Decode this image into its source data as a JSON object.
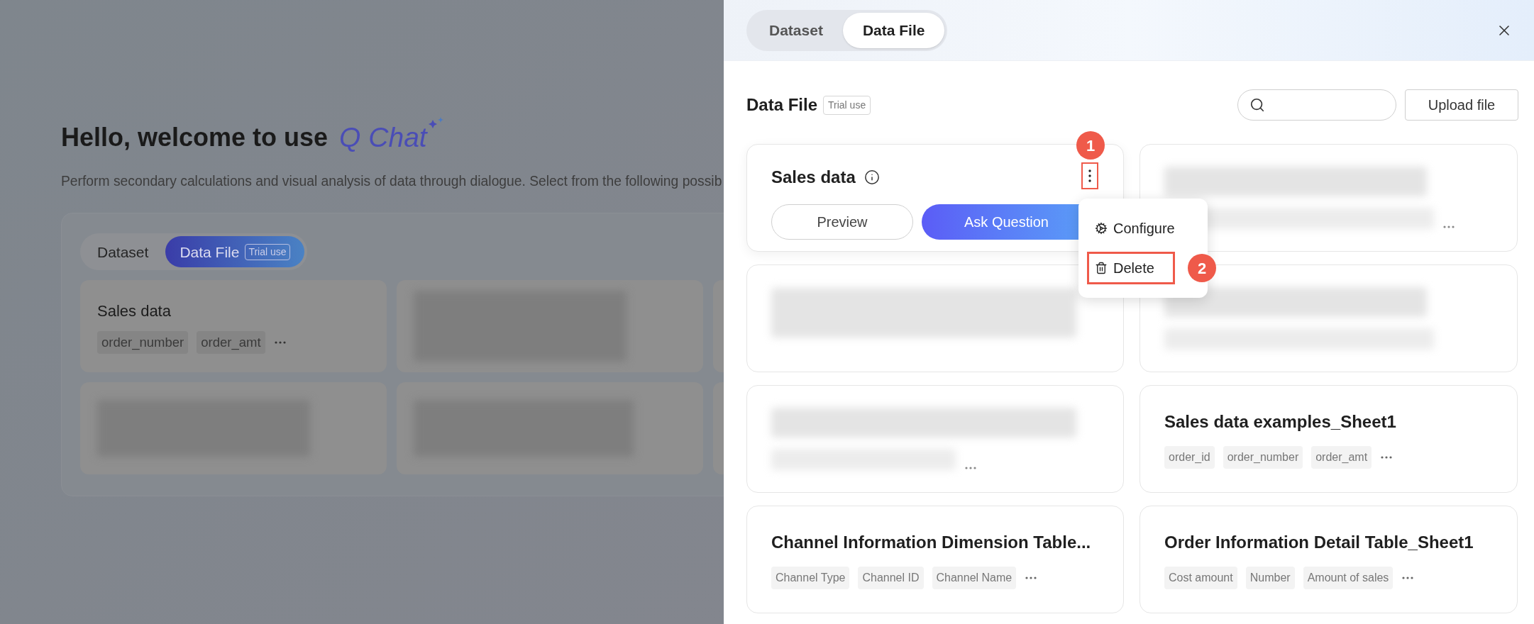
{
  "background": {
    "greeting": "Hello, welcome to use",
    "brand": "Q Chat",
    "subtitle": "Perform secondary calculations and visual analysis of data through dialogue. Select from the following possib",
    "tabs": [
      {
        "label": "Dataset",
        "selected": false
      },
      {
        "label": "Data File",
        "selected": true,
        "badge": "Trial use"
      }
    ],
    "cards": [
      {
        "kind": "file",
        "title": "Sales data",
        "tags": [
          "order_number",
          "order_amt"
        ],
        "more": true
      },
      {
        "kind": "blurred",
        "more": false
      },
      {
        "kind": "edge"
      },
      {
        "kind": "blurred",
        "more": false
      },
      {
        "kind": "blurred",
        "more": false
      },
      {
        "kind": "edge"
      }
    ]
  },
  "drawer": {
    "tabs": [
      {
        "label": "Dataset",
        "selected": false
      },
      {
        "label": "Data File",
        "selected": true
      }
    ],
    "heading": "Data File",
    "badge": "Trial use",
    "upload_button": "Upload file",
    "cards": [
      {
        "kind": "active",
        "title": "Sales data",
        "buttons": [
          "Preview",
          "Ask Question"
        ],
        "callout": "1",
        "menu": [
          {
            "kind": "configure",
            "label": "Configure",
            "highlighted": false
          },
          {
            "kind": "delete",
            "label": "Delete",
            "highlighted": true,
            "callout": "2"
          }
        ]
      },
      {
        "kind": "blurred",
        "more": true
      },
      {
        "kind": "blurred",
        "more": false
      },
      {
        "kind": "blurred",
        "more": false
      },
      {
        "kind": "blurred",
        "more": true
      },
      {
        "kind": "file",
        "title": "Sales data examples_Sheet1",
        "tags": [
          "order_id",
          "order_number",
          "order_amt"
        ],
        "more": true
      },
      {
        "kind": "file",
        "title": "Channel Information Dimension Table...",
        "tags": [
          "Channel Type",
          "Channel ID",
          "Channel Name"
        ],
        "more": true
      },
      {
        "kind": "file",
        "title": "Order Information Detail Table_Sheet1",
        "tags": [
          "Cost amount",
          "Number",
          "Amount of sales"
        ],
        "more": true
      }
    ]
  }
}
